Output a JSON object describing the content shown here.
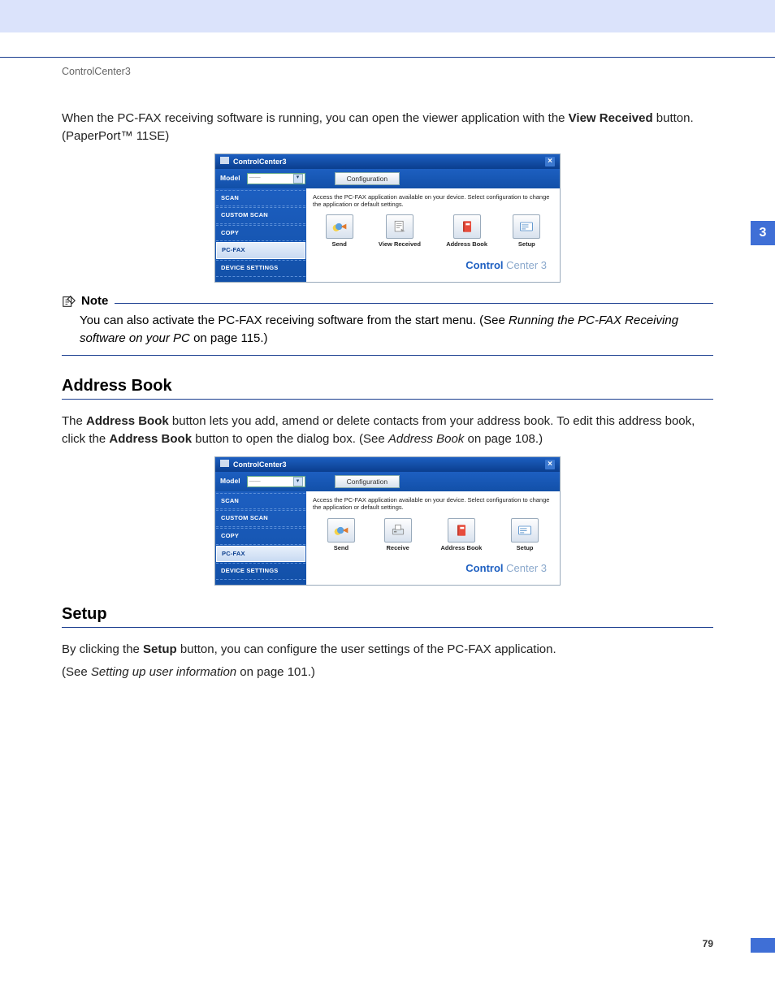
{
  "headerSmall": "ControlCenter3",
  "chapterTab": "3",
  "pageNumber": "79",
  "intro": {
    "t1": "When the PC-FAX receiving software is running, you can open the viewer application with the ",
    "bold1": "View Received",
    "t2": " button. (PaperPort™ 11SE)"
  },
  "note": {
    "title": "Note",
    "t1": "You can also activate the PC-FAX receiving software from the start menu. (See ",
    "i1": "Running the PC-FAX Receiving software on your PC",
    "t2": " on page 115.)"
  },
  "addressBook": {
    "heading": "Address Book",
    "t1": "The ",
    "b1": "Address Book",
    "t2": " button lets you add, amend or delete contacts from your address book. To edit this address book, click the ",
    "b2": "Address Book",
    "t3": " button to open the dialog box. (See ",
    "i1": "Address Book",
    "t4": " on page 108.)"
  },
  "setup": {
    "heading": "Setup",
    "t1": "By clicking the ",
    "b1": "Setup",
    "t2": " button, you can configure the user settings of the PC-FAX application.",
    "t3": "(See ",
    "i1": "Setting up user information",
    "t4": " on page 101.)"
  },
  "cc": {
    "title": "ControlCenter3",
    "modelLabel": "Model",
    "configBtn": "Configuration",
    "desc": "Access the PC-FAX application available on your device. Select configuration to change the application or default settings.",
    "sidebar": [
      "SCAN",
      "CUSTOM SCAN",
      "COPY",
      "PC-FAX",
      "DEVICE SETTINGS"
    ],
    "brandBold": "Control",
    "brandLight": " Center 3",
    "win1buttons": [
      "Send",
      "View Received",
      "Address Book",
      "Setup"
    ],
    "win2buttons": [
      "Send",
      "Receive",
      "Address Book",
      "Setup"
    ]
  }
}
